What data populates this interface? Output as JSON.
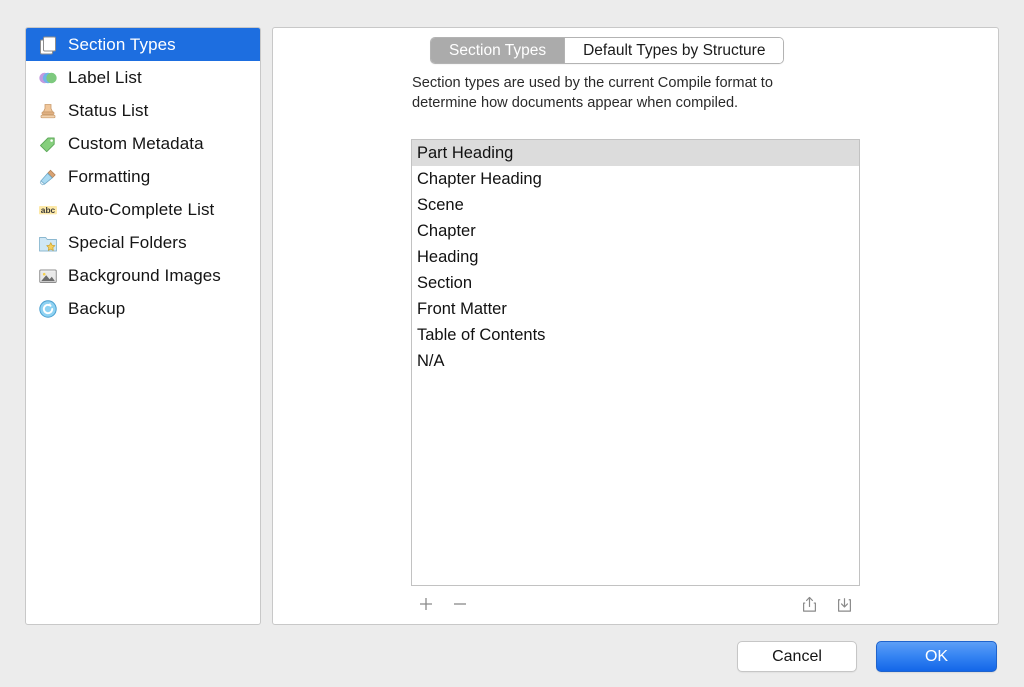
{
  "sidebar": {
    "items": [
      {
        "label": "Section Types",
        "icon": "documents-icon",
        "selected": true
      },
      {
        "label": "Label List",
        "icon": "color-circles-icon",
        "selected": false
      },
      {
        "label": "Status List",
        "icon": "rubber-stamp-icon",
        "selected": false
      },
      {
        "label": "Custom Metadata",
        "icon": "green-tag-icon",
        "selected": false
      },
      {
        "label": "Formatting",
        "icon": "paintbrush-icon",
        "selected": false
      },
      {
        "label": "Auto-Complete List",
        "icon": "abc-text-icon",
        "selected": false
      },
      {
        "label": "Special Folders",
        "icon": "folder-star-icon",
        "selected": false
      },
      {
        "label": "Background Images",
        "icon": "picture-icon",
        "selected": false
      },
      {
        "label": "Backup",
        "icon": "circular-arrow-icon",
        "selected": false
      }
    ]
  },
  "panel": {
    "tabs": [
      {
        "label": "Section Types",
        "active": true
      },
      {
        "label": "Default Types by Structure",
        "active": false
      }
    ],
    "description": "Section types are used by the current Compile format to determine how documents appear when compiled.",
    "list": [
      {
        "label": "Part Heading",
        "selected": true
      },
      {
        "label": "Chapter Heading",
        "selected": false
      },
      {
        "label": "Scene",
        "selected": false
      },
      {
        "label": "Chapter",
        "selected": false
      },
      {
        "label": "Heading",
        "selected": false
      },
      {
        "label": "Section",
        "selected": false
      },
      {
        "label": "Front Matter",
        "selected": false
      },
      {
        "label": "Table of Contents",
        "selected": false
      },
      {
        "label": "N/A",
        "selected": false
      }
    ],
    "toolbar": {
      "add": "+",
      "remove": "−",
      "share": "share-icon",
      "import": "import-icon"
    }
  },
  "footer": {
    "cancel_label": "Cancel",
    "ok_label": "OK"
  },
  "colors": {
    "selection_blue": "#1d6ee0",
    "tab_active_gray": "#ababab",
    "row_selected_gray": "#dcdcdc",
    "ok_blue": "#1366e8",
    "window_background": "#ececec"
  }
}
